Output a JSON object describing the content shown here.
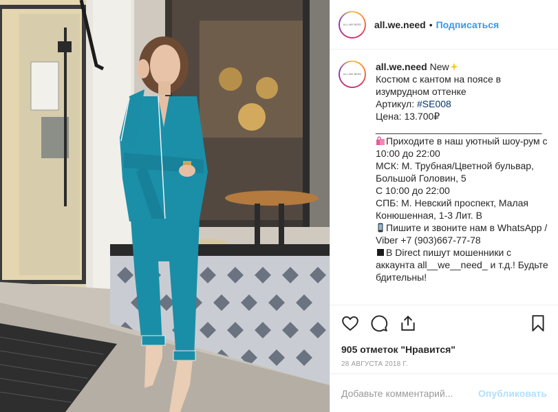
{
  "post": {
    "username": "all.we.need",
    "avatar_text": "ALL.WE.NEED",
    "follow_label": "Подписаться",
    "header_dot": "•"
  },
  "caption": {
    "username": "all.we.need",
    "lines": [
      "New",
      "Костюм с кантом на поясе в изумрудном оттенке",
      "Артикул: ",
      "#SE008",
      "Цена: 13.700₽",
      "_______________________________",
      "Приходите в наш уютный шоу-рум с 10:00 до 22:00",
      "МСК: М. Трубная/Цветной бульвар, Большой Головин, 5",
      "С 10:00 до 22:00",
      "СПБ: М. Невский проспект, Малая Конюшенная, 1-3 Лит. В",
      "Пишите и звоните нам в WhatsApp / Viber +7 (903)667-77-78",
      "В Direct пишут мошенники с аккаунта all__we__need_ и т.д.! Будьте бдительны!"
    ],
    "icons": {
      "sparkles": "sparkles-icon",
      "bags": "shopping-bags-icon",
      "phone": "mobile-phone-icon",
      "black_square": "black-square-icon"
    }
  },
  "actions": {
    "like_icon": "heart-icon",
    "comment_icon": "comment-icon",
    "share_icon": "share-icon",
    "save_icon": "bookmark-icon"
  },
  "likes_text": "905 отметок \"Нравится\"",
  "date_text": "28 августа 2018 г.",
  "comment": {
    "placeholder": "Добавьте комментарий...",
    "publish_label": "Опубликовать"
  },
  "colors": {
    "link": "#3897f0",
    "hashtag": "#003569",
    "publish_disabled": "#b2dffc",
    "border": "#efefef",
    "muted": "#999999"
  }
}
